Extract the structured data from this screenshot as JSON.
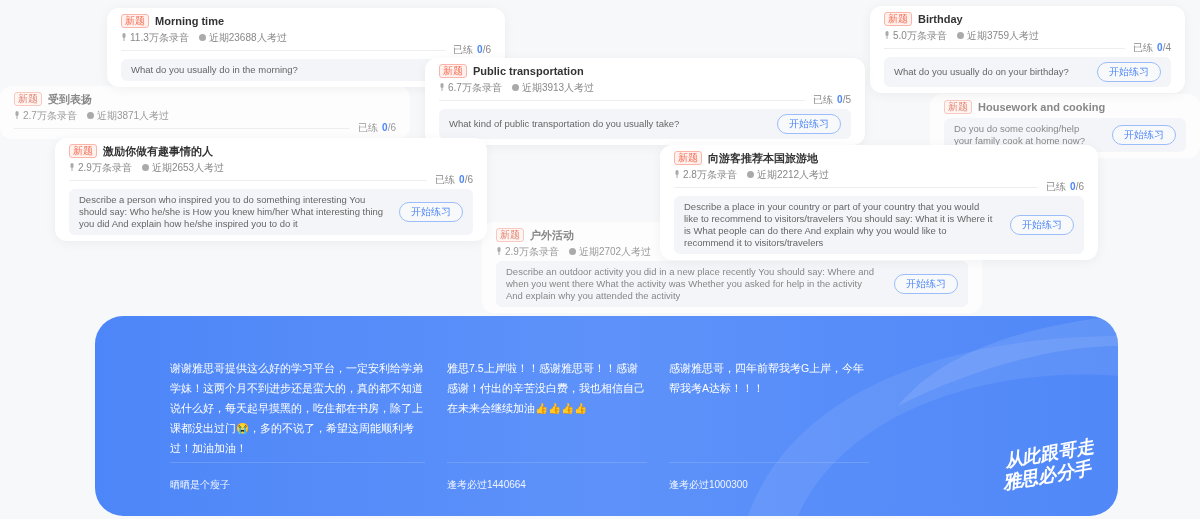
{
  "cards": [
    {
      "kind": "card",
      "tag": "新题",
      "title": "Morning time",
      "recordings": "11.3万条录音",
      "takers": "近期23688人考过",
      "progress_label": "已练",
      "done": "0",
      "total": "/6",
      "question": "What do you usually do in the morning?"
    },
    {
      "kind": "faded",
      "tag": "新题",
      "title": "受到表扬",
      "recordings": "2.7万条录音",
      "takers": "近期3871人考过",
      "progress_label": "已练",
      "done": "0",
      "total": "/6"
    },
    {
      "kind": "card",
      "tag": "新题",
      "title": "Public transportation",
      "recordings": "6.7万条录音",
      "takers": "近期3913人考过",
      "progress_label": "已练",
      "done": "0",
      "total": "/5",
      "question": "What kind of public transportation do you usually take?",
      "button": "开始练习"
    },
    {
      "kind": "card",
      "tag": "新题",
      "title": "Birthday",
      "recordings": "5.0万条录音",
      "takers": "近期3759人考过",
      "progress_label": "已练",
      "done": "0",
      "total": "/4",
      "question": "What do you usually do on your birthday?",
      "button": "开始练习"
    },
    {
      "kind": "faded",
      "tag": "新题",
      "title": "Housework and cooking",
      "question": "Do you do some cooking/help your family cook at home now?",
      "button": "开始练习"
    },
    {
      "kind": "faded",
      "tag": "新题",
      "title": "户外活动",
      "recordings": "2.9万条录音",
      "takers": "近期2702人考过",
      "question": "Describe an outdoor activity you did in a new place recently You should say: Where and when you went there What the activity was Whether you asked for help in the activity And explain why you attended the activity",
      "button": "开始练习"
    },
    {
      "kind": "card",
      "tag": "新题",
      "title": "激励你做有趣事情的人",
      "recordings": "2.9万条录音",
      "takers": "近期2653人考过",
      "progress_label": "已练",
      "done": "0",
      "total": "/6",
      "question": "Describe a person who inspired you to do something interesting You should say: Who he/she is How you knew him/her What interesting thing you did And explain how he/she inspired you to do it",
      "button": "开始练习"
    },
    {
      "kind": "card",
      "tag": "新题",
      "title": "向游客推荐本国旅游地",
      "recordings": "2.8万条录音",
      "takers": "近期2212人考过",
      "progress_label": "已练",
      "done": "0",
      "total": "/6",
      "question": "Describe a place in your country or part of your country that you would like to recommend to visitors/travelers You should say: What it is Where it is What people can do there And explain why you would like to recommend it to visitors/travelers",
      "button": "开始练习"
    }
  ],
  "testimonials": [
    {
      "text": "谢谢雅思哥提供这么好的学习平台，一定安利给学弟学妹！这两个月不到进步还是蛮大的，真的都不知道说什么好，每天起早摸黑的，吃住都在书房，除了上课都没出过门😭，多的不说了，希望这周能顺利考过！加油加油！",
      "author": "晒晒是个瘦子"
    },
    {
      "text": "雅思7.5上岸啦！！感谢雅思哥！！感谢感谢！付出的辛苦没白费，我也相信自己在未来会继续加油👍👍👍👍",
      "author": "逢考必过1440664"
    },
    {
      "text": "感谢雅思哥，四年前帮我考G上岸，今年帮我考A达标！！！",
      "author": "逢考必过1000300"
    }
  ],
  "slogan": [
    "从此跟哥走",
    "雅思必分手"
  ]
}
